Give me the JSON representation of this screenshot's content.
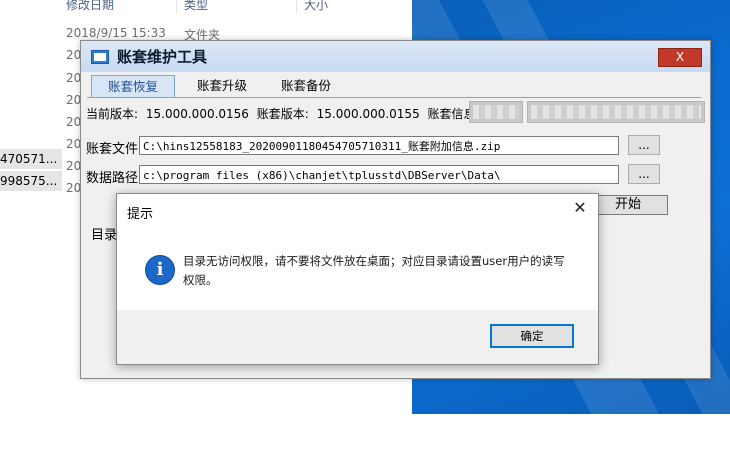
{
  "explorer": {
    "headers": [
      "修改日期",
      "类型",
      "大小"
    ],
    "rows": [
      {
        "date": "2018/9/15 15:33",
        "type": "文件夹"
      },
      {
        "date": "20"
      },
      {
        "date": "20"
      },
      {
        "date": "20"
      },
      {
        "date": "20"
      },
      {
        "date": "20"
      },
      {
        "date": "20"
      },
      {
        "date": "20"
      }
    ],
    "left_items": [
      "470571...",
      "998575..."
    ]
  },
  "tool": {
    "title": "账套维护工具",
    "close_label": "X",
    "tabs": [
      {
        "label": "账套恢复",
        "active": true
      },
      {
        "label": "账套升级",
        "active": false
      },
      {
        "label": "账套备份",
        "active": false
      }
    ],
    "info": {
      "current_version_label": "当前版本:",
      "current_version": "15.000.000.0156",
      "account_version_label": "账套版本:",
      "account_version": "15.000.000.0155",
      "account_info_label": "账套信息:"
    },
    "file_label": "账套文件",
    "file_value": "C:\\hins12558183_20200901180454705710311_账套附加信息.zip",
    "path_label": "数据路径",
    "path_value": "c:\\program files (x86)\\chanjet\\tplusstd\\DBServer\\Data\\",
    "browse_label": "...",
    "start_label": "开始",
    "dir_label": "目录"
  },
  "dialog": {
    "title": "提示",
    "close_glyph": "✕",
    "info_glyph": "i",
    "message": "目录无访问权限，请不要将文件放在桌面；对应目录请设置user用户的读写权限。",
    "ok_label": "确定"
  }
}
